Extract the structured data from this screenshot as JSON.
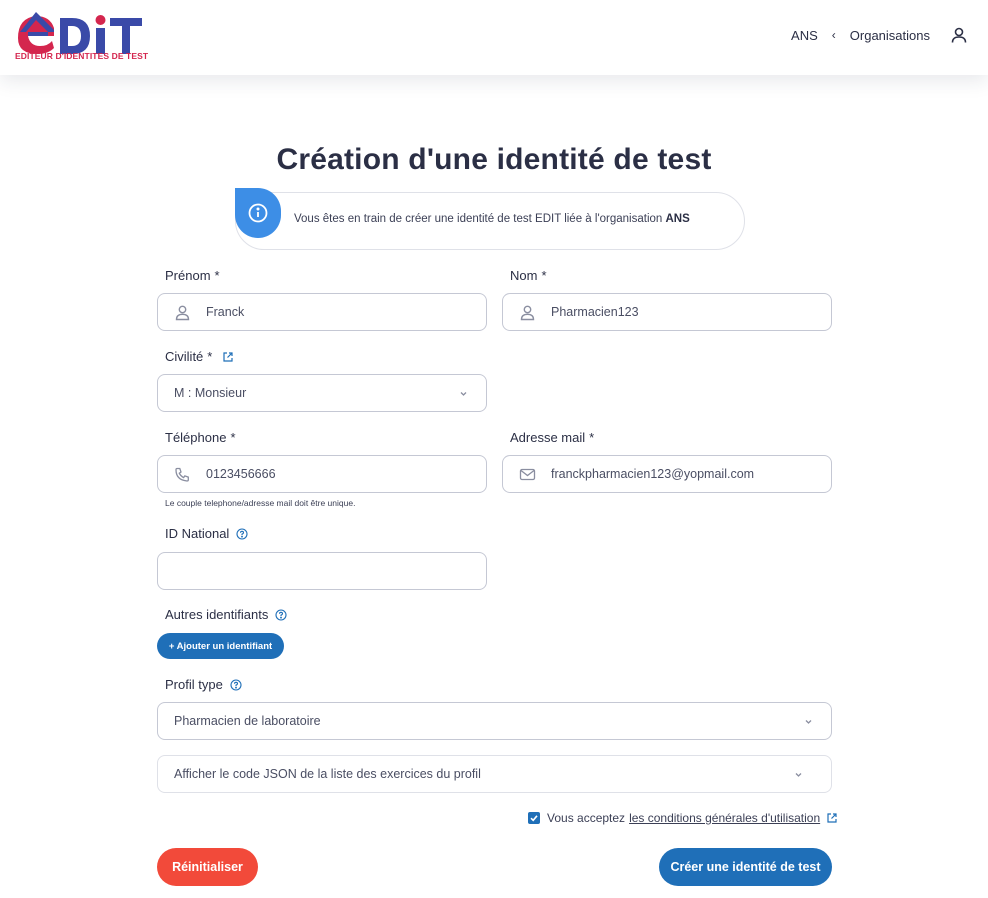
{
  "header": {
    "logo_text": "EDiT",
    "logo_subtitle": "EDITEUR D'IDENTITES DE TEST",
    "nav": {
      "crumb_current": "ANS",
      "crumb_separator": "‹",
      "crumb_link": "Organisations"
    }
  },
  "page": {
    "title": "Création d'une identité de test"
  },
  "info": {
    "text": "Vous êtes en train de créer une identité de test EDIT liée à l'organisation",
    "org": "ANS"
  },
  "form": {
    "prenom": {
      "label": "Prénom",
      "required": "*",
      "value": "Franck"
    },
    "nom": {
      "label": "Nom",
      "required": "*",
      "value": "Pharmacien123"
    },
    "civilite": {
      "label": "Civilité",
      "required": "*",
      "value": "M : Monsieur"
    },
    "telephone": {
      "label": "Téléphone",
      "required": "*",
      "value": "0123456666"
    },
    "email": {
      "label": "Adresse mail",
      "required": "*",
      "value": "franckpharmacien123@yopmail.com"
    },
    "unique_hint": "Le couple telephone/adresse mail doit être unique.",
    "id_national": {
      "label": "ID National",
      "value": ""
    },
    "autres": {
      "label": "Autres identifiants",
      "button": "+ Ajouter un identifiant"
    },
    "profil": {
      "label": "Profil type",
      "value": "Pharmacien de laboratoire"
    },
    "json_toggle": "Afficher le code JSON de la liste des exercices du profil",
    "accept": {
      "prefix": "Vous acceptez",
      "link": "les conditions générales d'utilisation",
      "checked": true
    },
    "reset_button": "Réinitialiser",
    "create_button": "Créer une identité de test"
  },
  "colors": {
    "primary": "#1f6fb8",
    "danger": "#f24a3a",
    "info": "#3d8ee6",
    "logo_blue": "#3a4aa8",
    "logo_red": "#d4264e"
  },
  "icons": {
    "user": "user-icon",
    "phone": "phone-icon",
    "mail": "mail-icon",
    "chevron": "chevron-down-icon",
    "help": "help-circle-icon",
    "external": "external-link-icon",
    "info": "info-icon"
  }
}
